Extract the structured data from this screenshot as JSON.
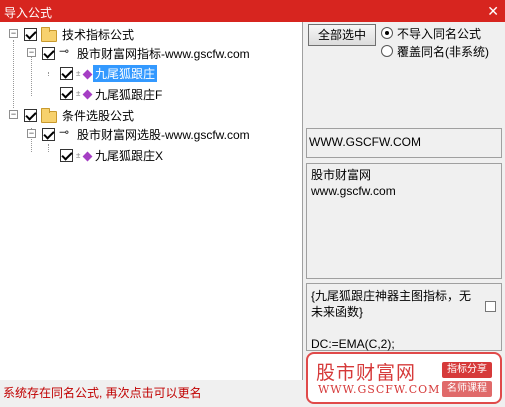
{
  "window": {
    "title": "导入公式",
    "close_glyph": "✕"
  },
  "tree": {
    "groups": [
      {
        "label": "技术指标公式",
        "children": [
          {
            "label": "股市财富网指标-www.gscfw.com",
            "children": [
              {
                "label": "九尾狐跟庄",
                "selected": true
              }
            ]
          },
          {
            "label": "九尾狐跟庄F"
          }
        ]
      },
      {
        "label": "条件选股公式",
        "children": [
          {
            "label": "股市财富网选股-www.gscfw.com",
            "children": [
              {
                "label": "九尾狐跟庄X"
              }
            ]
          }
        ]
      }
    ]
  },
  "options": {
    "select_all_label": "全部选中",
    "radio_skip": "不导入同名公式",
    "radio_overwrite": "覆盖同名(非系统)"
  },
  "info": {
    "header": "WWW.GSCFW.COM",
    "desc_line1": "股市财富网",
    "desc_line2": "www.gscfw.com",
    "formula_line1": "{九尾狐跟庄神器主图指标，无",
    "formula_line2": "未来函数}",
    "formula_code": "DC:=EMA(C,2);"
  },
  "status": "系统存在同名公式, 再次点击可以更名",
  "watermark": {
    "name": "股市财富网",
    "url": "WWW.GSCFW.COM",
    "tag1": "指标分享",
    "tag2": "名师课程"
  },
  "colors": {
    "title_bar": "#d7251f",
    "selection": "#3399ff",
    "status_text": "#c00000",
    "watermark": "#d63a3a"
  }
}
